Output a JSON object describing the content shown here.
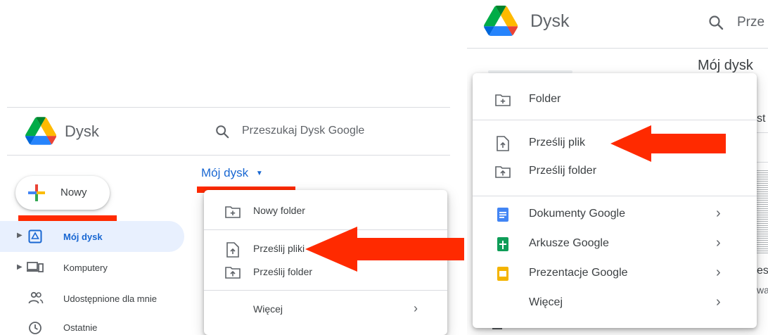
{
  "left": {
    "app_name": "Dysk",
    "search_placeholder": "Przeszukaj Dysk Google",
    "new_button_label": "Nowy",
    "breadcrumb_label": "Mój dysk",
    "sidebar": [
      {
        "label": "Mój dysk",
        "icon": "my-drive-icon",
        "active": true
      },
      {
        "label": "Komputery",
        "icon": "computers-icon",
        "active": false
      },
      {
        "label": "Udostępnione dla mnie",
        "icon": "shared-with-me-icon",
        "active": false
      },
      {
        "label": "Ostatnie",
        "icon": "clock-icon",
        "active": false
      }
    ],
    "menu": {
      "new_folder": "Nowy folder",
      "upload_files": "Prześlij pliki",
      "upload_folder": "Prześlij folder",
      "more": "Więcej"
    }
  },
  "right": {
    "app_name": "Dysk",
    "search_placeholder": "Prze",
    "breadcrumb_label": "Mój dysk",
    "menu": {
      "folder": "Folder",
      "upload_file": "Prześlij plik",
      "upload_folder": "Prześlij folder",
      "docs": "Dokumenty Google",
      "sheets": "Arkusze Google",
      "slides": "Prezentacje Google",
      "more": "Więcej"
    },
    "background_fragments": {
      "a": "st",
      "b": "es",
      "c": "wa"
    }
  },
  "colors": {
    "accent_blue": "#1967d2",
    "active_bg": "#e8f0fe",
    "annotation_red": "#ff2a00",
    "docs_blue": "#4285f4",
    "sheets_green": "#0f9d58",
    "slides_yellow": "#f4b400"
  }
}
